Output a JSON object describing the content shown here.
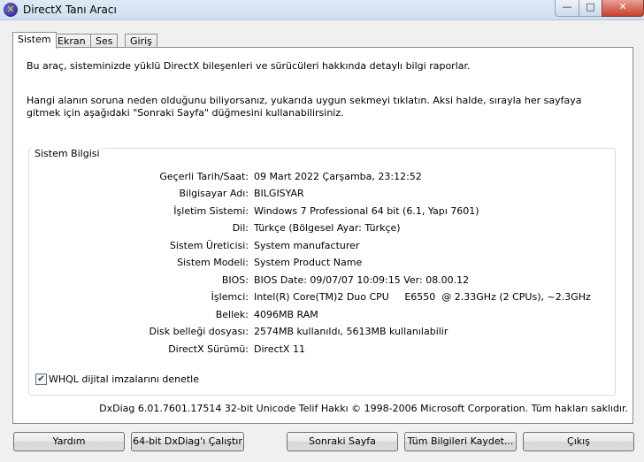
{
  "window": {
    "title": "DirectX Tanı Aracı",
    "app_icon": "directx-icon",
    "controls": {
      "minimize": "—",
      "maximize": "□",
      "close": "✕"
    }
  },
  "tabs": [
    {
      "label": "Sistem"
    },
    {
      "label": "Ekran"
    },
    {
      "label": "Ses"
    },
    {
      "label": "Giriş"
    }
  ],
  "intro": {
    "line1": "Bu araç, sisteminizde yüklü DirectX bileşenleri ve sürücüleri hakkında detaylı bilgi raporlar.",
    "line2": "Hangi alanın soruna neden olduğunu biliyorsanız, yukarıda uygun sekmeyi tıklatın.  Aksi halde, sırayla her sayfaya gitmek için aşağıdaki \"Sonraki Sayfa\" düğmesini kullanabilirsiniz."
  },
  "system_info": {
    "heading": "Sistem Bilgisi",
    "rows": [
      {
        "label": "Geçerli Tarih/Saat:",
        "value": "09 Mart 2022 Çarşamba, 23:12:52"
      },
      {
        "label": "Bilgisayar Adı:",
        "value": "BILGISYAR"
      },
      {
        "label": "İşletim Sistemi:",
        "value": "Windows 7 Professional 64 bit (6.1, Yapı 7601)"
      },
      {
        "label": "Dil:",
        "value": "Türkçe (Bölgesel Ayar: Türkçe)"
      },
      {
        "label": "Sistem Üreticisi:",
        "value": "System manufacturer"
      },
      {
        "label": "Sistem Modeli:",
        "value": "System Product Name"
      },
      {
        "label": "BIOS:",
        "value": "BIOS Date: 09/07/07 10:09:15 Ver: 08.00.12"
      },
      {
        "label": "İşlemci:",
        "value": "Intel(R) Core(TM)2 Duo CPU     E6550  @ 2.33GHz (2 CPUs), ~2.3GHz"
      },
      {
        "label": "Bellek:",
        "value": "4096MB RAM"
      },
      {
        "label": "Disk belleği dosyası:",
        "value": "2574MB kullanıldı, 5613MB kullanılabilir"
      },
      {
        "label": "DirectX Sürümü:",
        "value": "DirectX 11"
      }
    ]
  },
  "whql": {
    "label": "WHQL dijital imzalarını denetle",
    "checked": true
  },
  "footer_text": "DxDiag 6.01.7601.17514 32-bit Unicode  Telif Hakkı © 1998-2006 Microsoft Corporation.  Tüm hakları saklıdır.",
  "buttons": {
    "help": "Yardım",
    "run64": "64-bit DxDiag'ı Çalıştır",
    "next": "Sonraki Sayfa",
    "save_all": "Tüm Bilgileri Kaydet...",
    "exit": "Çıkış"
  }
}
